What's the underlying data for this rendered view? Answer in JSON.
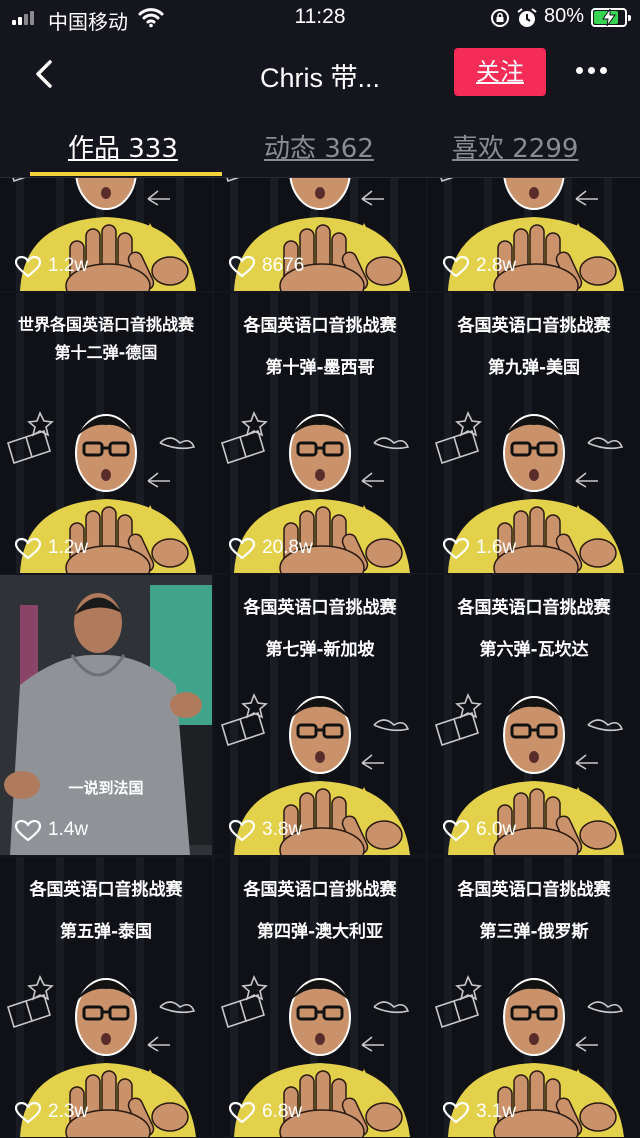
{
  "status_bar": {
    "carrier": "中国移动",
    "time": "11:28",
    "battery_percent": "80%",
    "battery_level": 0.8,
    "battery_color": "#39d353",
    "signal_icon": "signal-bars-icon",
    "wifi_icon": "wifi-icon",
    "rotation_lock_icon": "rotation-lock-icon",
    "alarm_icon": "alarm-clock-icon"
  },
  "nav": {
    "back_icon": "chevron-left-icon",
    "title": "Chris 带...",
    "follow_label": "关注",
    "follow_color": "#f52c56",
    "more_icon": "more-dots-icon"
  },
  "tabs": [
    {
      "label": "作品 333",
      "active": true
    },
    {
      "label": "动态 362",
      "active": false
    },
    {
      "label": "喜欢 2299",
      "active": false
    }
  ],
  "tab_indicator_color": "#f4d23a",
  "videos": [
    {
      "title": "",
      "subtitle": "",
      "caption": "",
      "likes": "1.2w"
    },
    {
      "title": "",
      "subtitle": "",
      "caption": "",
      "likes": "8676"
    },
    {
      "title": "",
      "subtitle": "",
      "caption": "",
      "likes": "2.8w"
    },
    {
      "title": "世界各国英语口音挑战赛",
      "subtitle": "第十二弹-德国",
      "caption": "",
      "likes": "1.2w"
    },
    {
      "title": "各国英语口音挑战赛",
      "subtitle": "第十弹-墨西哥",
      "caption": "",
      "likes": "20.8w"
    },
    {
      "title": "各国英语口音挑战赛",
      "subtitle": "第九弹-美国",
      "caption": "",
      "likes": "1.6w"
    },
    {
      "title": "",
      "subtitle": "",
      "caption": "一说到法国",
      "likes": "1.4w"
    },
    {
      "title": "各国英语口音挑战赛",
      "subtitle": "第七弹-新加坡",
      "caption": "",
      "likes": "3.8w"
    },
    {
      "title": "各国英语口音挑战赛",
      "subtitle": "第六弹-瓦坎达",
      "caption": "",
      "likes": "6.0w"
    },
    {
      "title": "各国英语口音挑战赛",
      "subtitle": "第五弹-泰国",
      "caption": "",
      "likes": "2.3w"
    },
    {
      "title": "各国英语口音挑战赛",
      "subtitle": "第四弹-澳大利亚",
      "caption": "",
      "likes": "6.8w"
    },
    {
      "title": "各国英语口音挑战赛",
      "subtitle": "第三弹-俄罗斯",
      "caption": "",
      "likes": "3.1w"
    }
  ],
  "like_icon": "heart-outline-icon"
}
